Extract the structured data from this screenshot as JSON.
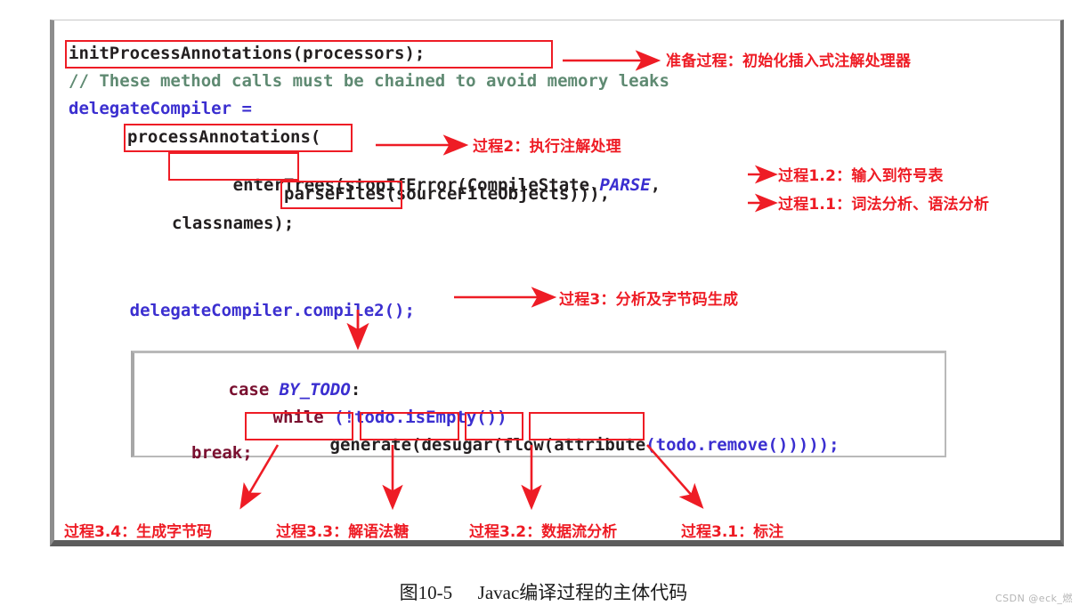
{
  "figure": {
    "caption_number": "图10-5",
    "caption_text": "Javac编译过程的主体代码",
    "watermark": "CSDN @eck_燃",
    "accent_color": "#ee1c25",
    "identifier_color": "#3b2fd0",
    "comment_color": "#5f8a72",
    "keyword_color": "#7a1030",
    "frame_border_color": "#8d8d8d"
  },
  "code": {
    "outer_lines": [
      {
        "id": "line-init",
        "text": "initProcessAnnotations(processors);"
      },
      {
        "id": "line-comment",
        "text": "// These method calls must be chained to avoid memory leaks"
      },
      {
        "id": "line-delegate",
        "text": "delegateCompiler ="
      },
      {
        "id": "line-process",
        "text": "processAnnotations("
      },
      {
        "id": "line-enter",
        "text": "enterTrees(stopIfError(CompileState."
      },
      {
        "id": "line-enter-2",
        "text": "PARSE"
      },
      {
        "id": "line-enter-3",
        "text": ","
      },
      {
        "id": "line-parse",
        "text": "parseFiles(sourceFileObjects))),"
      },
      {
        "id": "line-classname",
        "text": "classnames);"
      },
      {
        "id": "line-compile2",
        "text": "delegateCompiler.compile2();"
      }
    ],
    "inner_lines": [
      {
        "id": "line-case",
        "kw": "case",
        "const": "BY_TODO",
        "tail": ":"
      },
      {
        "id": "line-while",
        "kw": "while",
        "tail": " (!todo.isEmpty())"
      },
      {
        "id": "line-calls",
        "a": "generate",
        "b": "desugar",
        "c": "flow",
        "d": "attribute",
        "tail": "(todo.remove()))));"
      },
      {
        "id": "line-break",
        "kw": "break;"
      }
    ]
  },
  "highlights": [
    {
      "name": "highlight-initProcessAnnotations",
      "label": "initProcessAnnotations(processors);"
    },
    {
      "name": "highlight-processAnnotations",
      "label": "processAnnotations"
    },
    {
      "name": "highlight-enterTrees",
      "label": "enterTrees"
    },
    {
      "name": "highlight-parseFiles",
      "label": "parseFiles"
    },
    {
      "name": "highlight-generate",
      "label": "generate"
    },
    {
      "name": "highlight-desugar",
      "label": "desugar"
    },
    {
      "name": "highlight-flow",
      "label": "flow"
    },
    {
      "name": "highlight-attribute",
      "label": "attribute"
    }
  ],
  "annotations": {
    "prepare": "准备过程：初始化插入式注解处理器",
    "process2": "过程2：执行注解处理",
    "process1_2": "过程1.2：输入到符号表",
    "process1_1": "过程1.1：词法分析、语法分析",
    "process3": "过程3：分析及字节码生成",
    "process3_4": "过程3.4：生成字节码",
    "process3_3": "过程3.3：解语法糖",
    "process3_2": "过程3.2：数据流分析",
    "process3_1": "过程3.1：标注"
  }
}
